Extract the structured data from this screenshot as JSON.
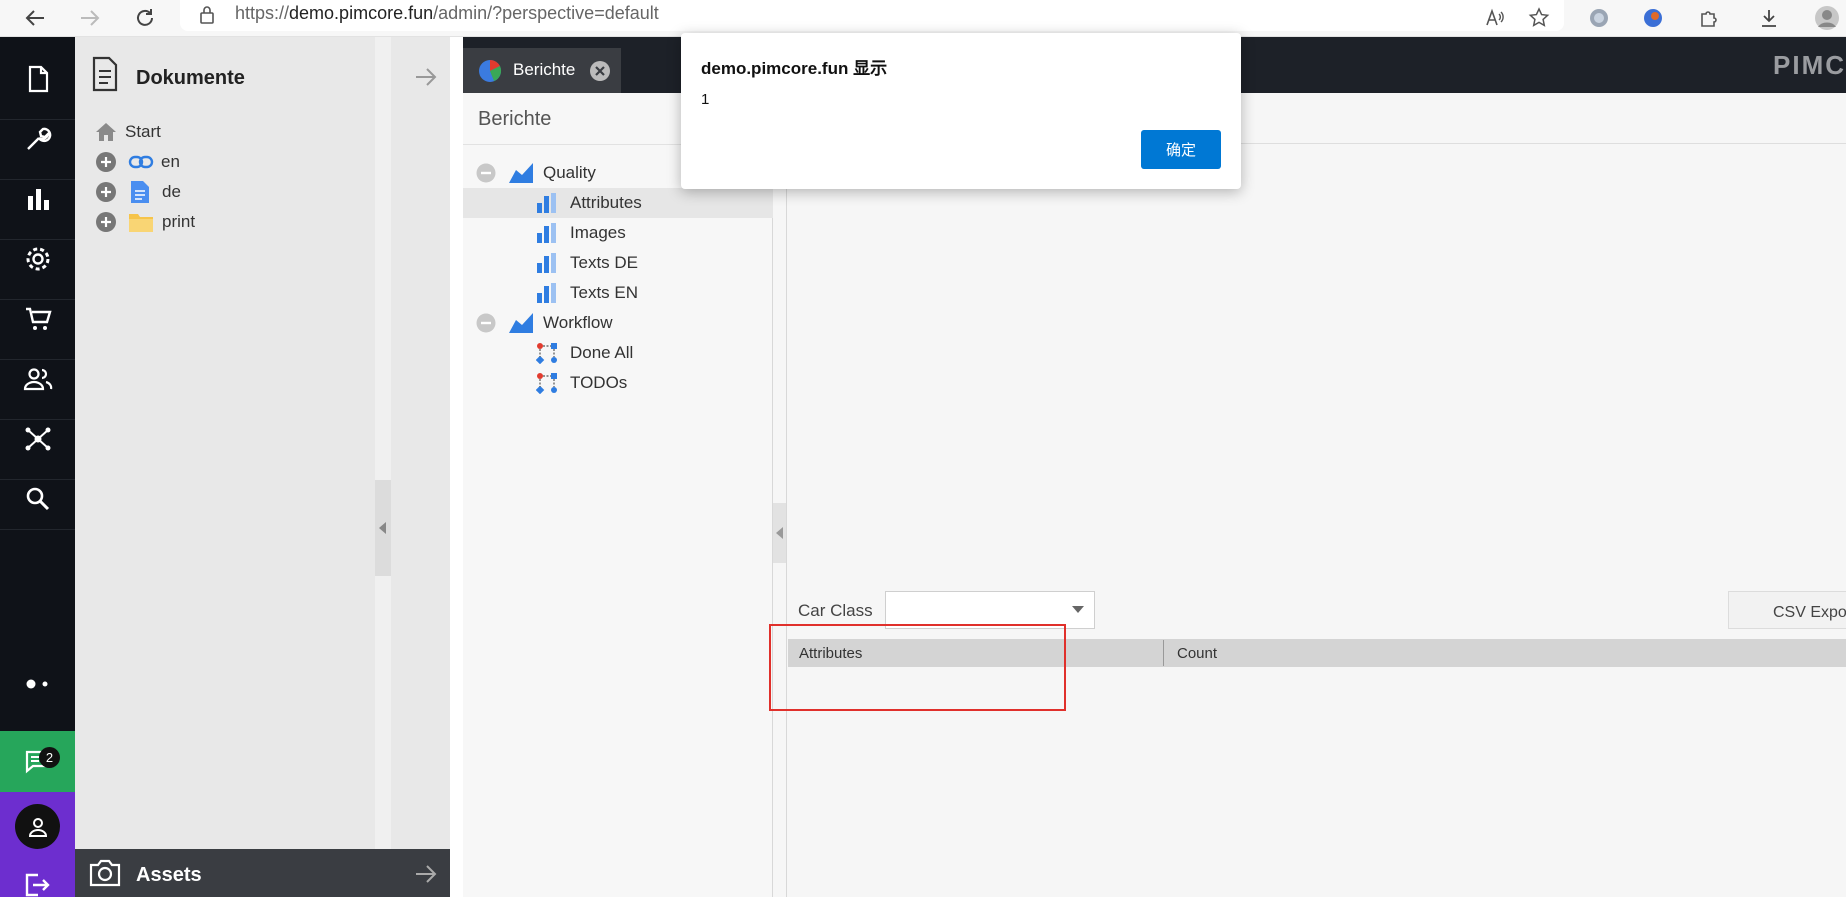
{
  "browser": {
    "url_prefix": "https://",
    "url_host": "demo.pimcore.fun",
    "url_path": "/admin/?perspective=default"
  },
  "nav": {
    "icons": [
      "document-icon",
      "wrench-icon",
      "bar-chart-icon",
      "gear-icon",
      "cart-icon",
      "users-icon",
      "network-icon",
      "search-icon"
    ],
    "chat_badge": "2"
  },
  "documents": {
    "title": "Dokumente",
    "tree": [
      {
        "label": "Start",
        "icon": "home-icon"
      },
      {
        "label": "en",
        "icon": "link-icon"
      },
      {
        "label": "de",
        "icon": "page-icon"
      },
      {
        "label": "print",
        "icon": "folder-icon"
      }
    ]
  },
  "assets": {
    "title": "Assets"
  },
  "tabs": [
    {
      "label": "Berichte"
    }
  ],
  "brand": "PIMC",
  "reports": {
    "title": "Berichte",
    "groups": [
      {
        "label": "Quality",
        "items": [
          "Attributes",
          "Images",
          "Texts DE",
          "Texts EN"
        ]
      },
      {
        "label": "Workflow",
        "items": [
          "Done All",
          "TODOs"
        ]
      }
    ],
    "selected": "Attributes"
  },
  "content": {
    "filter_label": "Car Class",
    "filter_value": "",
    "csv_button": "CSV Export",
    "columns": [
      "Attributes",
      "Count"
    ]
  },
  "alert": {
    "title": "demo.pimcore.fun 显示",
    "message": "1",
    "ok_label": "确定"
  },
  "colors": {
    "accent_blue": "#0078d4",
    "chat_green": "#26a65b",
    "user_purple": "#6d2ecf",
    "annotation_red": "#e0302b"
  }
}
